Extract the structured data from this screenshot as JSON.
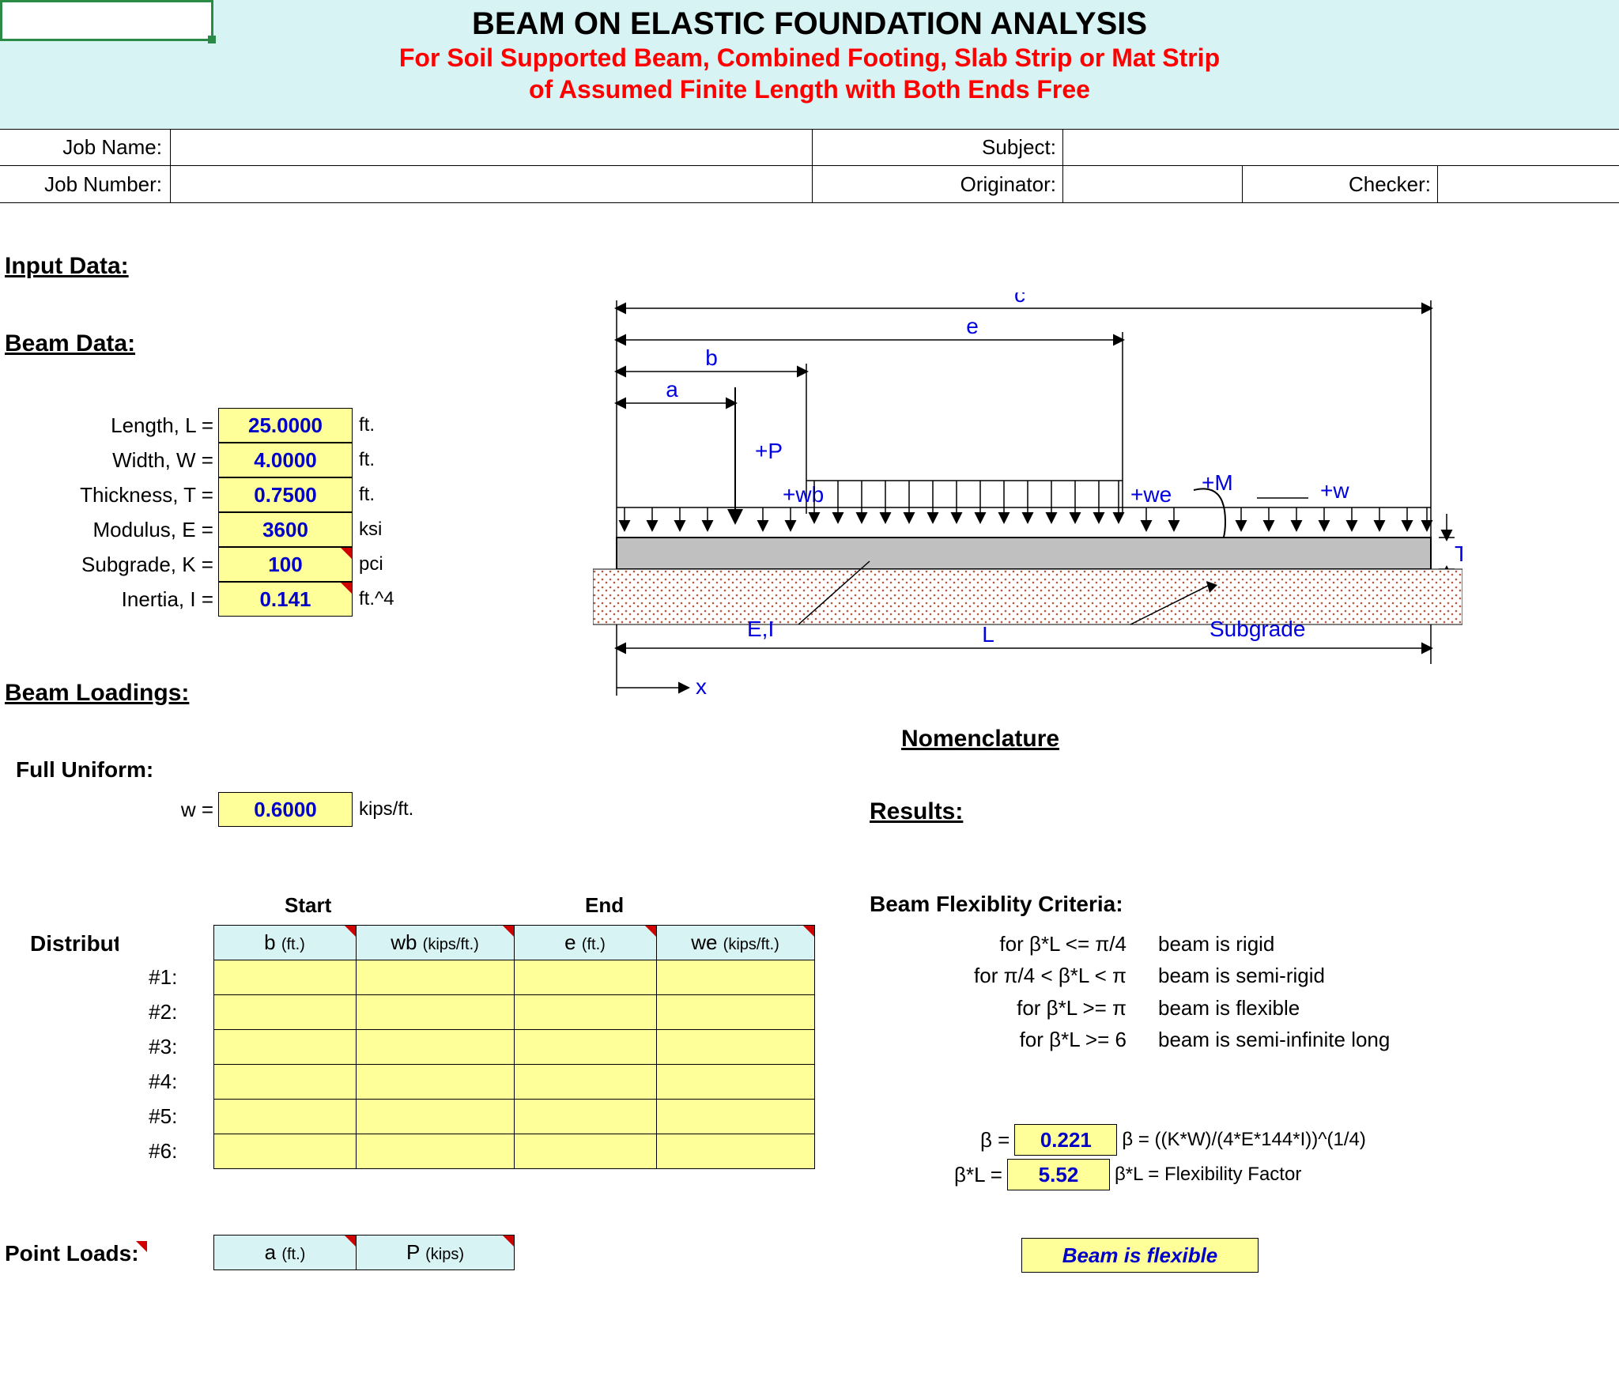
{
  "banner": {
    "title": "BEAM ON ELASTIC FOUNDATION ANALYSIS",
    "sub1": "For Soil Supported Beam, Combined Footing, Slab Strip or Mat Strip",
    "sub2": "of Assumed Finite Length with Both Ends Free"
  },
  "meta": {
    "job_name_lbl": "Job Name:",
    "job_name_val": "",
    "subject_lbl": "Subject:",
    "subject_val": "",
    "job_number_lbl": "Job Number:",
    "job_number_val": "",
    "originator_lbl": "Originator:",
    "originator_val": "",
    "checker_lbl": "Checker:",
    "checker_val": ""
  },
  "sections": {
    "input_data": "Input Data:",
    "beam_data": "Beam Data:",
    "beam_loadings": "Beam Loadings:",
    "full_uniform": "Full Uniform:",
    "distributed": "Distributed:",
    "point_loads": "Point Loads:",
    "nomenclature": "Nomenclature",
    "results": "Results:",
    "flex_criteria": "Beam Flexiblity Criteria:"
  },
  "beam_data": {
    "length_lbl": "Length, L =",
    "length_val": "25.0000",
    "length_unit": "ft.",
    "width_lbl": "Width, W =",
    "width_val": "4.0000",
    "width_unit": "ft.",
    "thick_lbl": "Thickness, T =",
    "thick_val": "0.7500",
    "thick_unit": "ft.",
    "mod_lbl": "Modulus, E =",
    "mod_val": "3600",
    "mod_unit": "ksi",
    "sub_lbl": "Subgrade, K =",
    "sub_val": "100",
    "sub_unit": "pci",
    "inertia_lbl": "Inertia, I =",
    "inertia_val": "0.141",
    "inertia_unit": "ft.^4"
  },
  "uniform": {
    "w_lbl": "w =",
    "w_val": "0.6000",
    "w_unit": "kips/ft."
  },
  "dist": {
    "start_hdr": "Start",
    "end_hdr": "End",
    "b_hdr": "b",
    "b_unit": "(ft.)",
    "wb_hdr": "wb",
    "wb_unit": "(kips/ft.)",
    "e_hdr": "e",
    "e_unit": "(ft.)",
    "we_hdr": "we",
    "we_unit": "(kips/ft.)",
    "rows": [
      "#1:",
      "#2:",
      "#3:",
      "#4:",
      "#5:",
      "#6:"
    ]
  },
  "point_loads": {
    "a_hdr": "a",
    "a_unit": "(ft.)",
    "p_hdr": "P",
    "p_unit": "(kips)"
  },
  "diagram": {
    "c": "c",
    "e": "e",
    "b": "b",
    "a": "a",
    "P": "+P",
    "wb": "+wb",
    "we": "+we",
    "M": "+M",
    "w": "+w",
    "EI": "E,I",
    "L": "L",
    "Subgrade": "Subgrade",
    "T": "T",
    "x": "x"
  },
  "results": {
    "criteria": [
      {
        "cond": "for β*L <= π/4",
        "res": "beam is rigid"
      },
      {
        "cond": "for π/4 < β*L < π",
        "res": "beam is semi-rigid"
      },
      {
        "cond": "for β*L >= π",
        "res": "beam is flexible"
      },
      {
        "cond": "for β*L >= 6",
        "res": "beam is semi-infinite long"
      }
    ],
    "beta_lbl": "β =",
    "beta_val": "0.221",
    "beta_formula": "β = ((K*W)/(4*E*144*I))^(1/4)",
    "bl_lbl": "β*L =",
    "bl_val": "5.52",
    "bl_formula": "β*L = Flexibility Factor",
    "conclusion": "Beam is flexible"
  }
}
